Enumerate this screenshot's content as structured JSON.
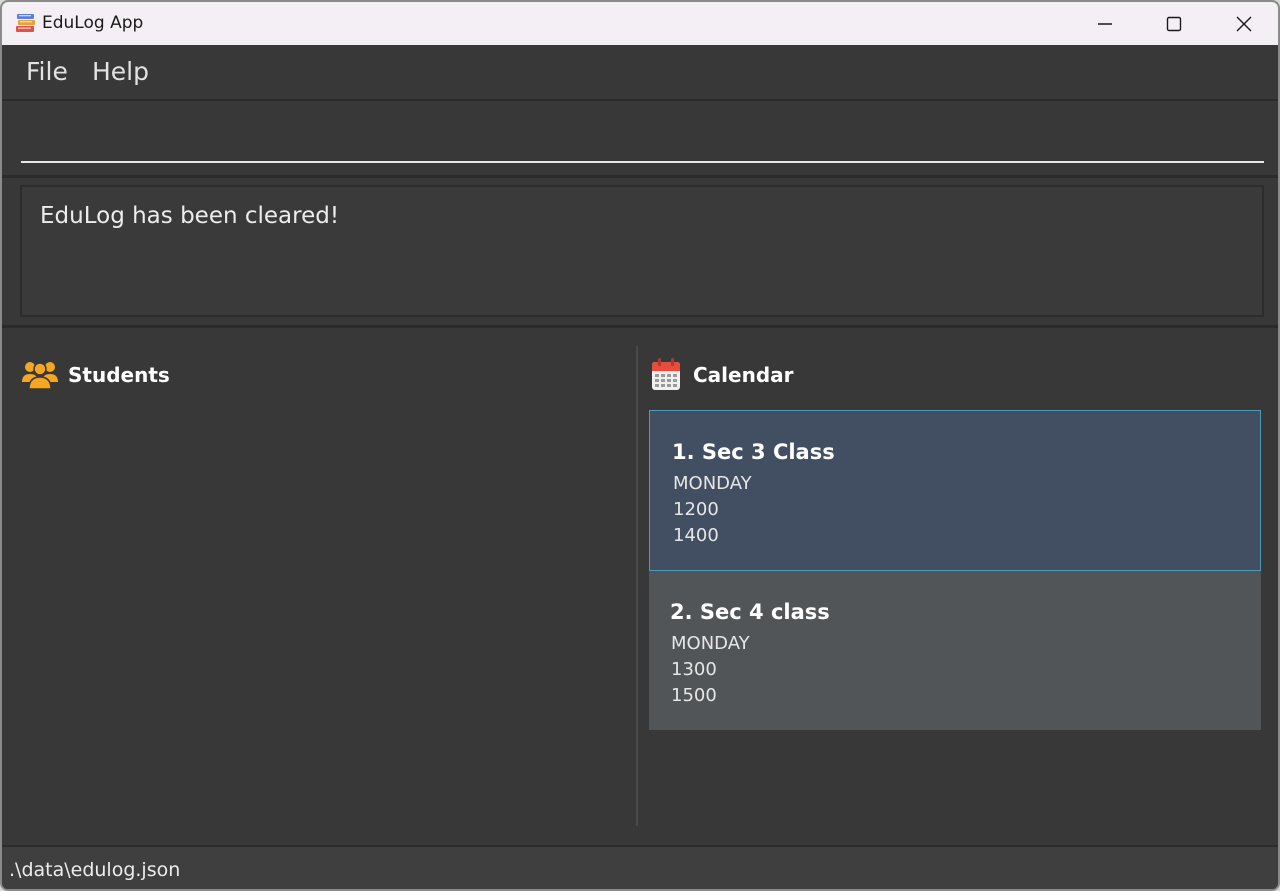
{
  "window": {
    "title": "EduLog App",
    "icon": "books-icon",
    "controls": [
      "minimize-icon",
      "maximize-icon",
      "close-icon"
    ]
  },
  "menu": {
    "items": [
      {
        "label": "File"
      },
      {
        "label": "Help"
      }
    ]
  },
  "command_box": {
    "value": "",
    "placeholder": ""
  },
  "result": {
    "text": "EduLog has been cleared!"
  },
  "students_panel": {
    "title": "Students",
    "icon": "users-icon",
    "items": []
  },
  "calendar_panel": {
    "title": "Calendar",
    "icon": "calendar-icon",
    "items": [
      {
        "title": "1. Sec 3 Class",
        "day": "MONDAY",
        "start": "1200",
        "end": "1400",
        "selected": true
      },
      {
        "title": "2. Sec 4 class",
        "day": "MONDAY",
        "start": "1300",
        "end": "1500",
        "selected": false
      }
    ]
  },
  "status_bar": {
    "path": ".\\data\\edulog.json"
  },
  "colors": {
    "background": "#383838",
    "titlebar": "#f4eef5",
    "selected_card": "#424e62",
    "selected_border": "#4a9ab8",
    "plain_card": "#515558",
    "users_icon": "#f5a623",
    "calendar_icon_top": "#e74c3c"
  }
}
